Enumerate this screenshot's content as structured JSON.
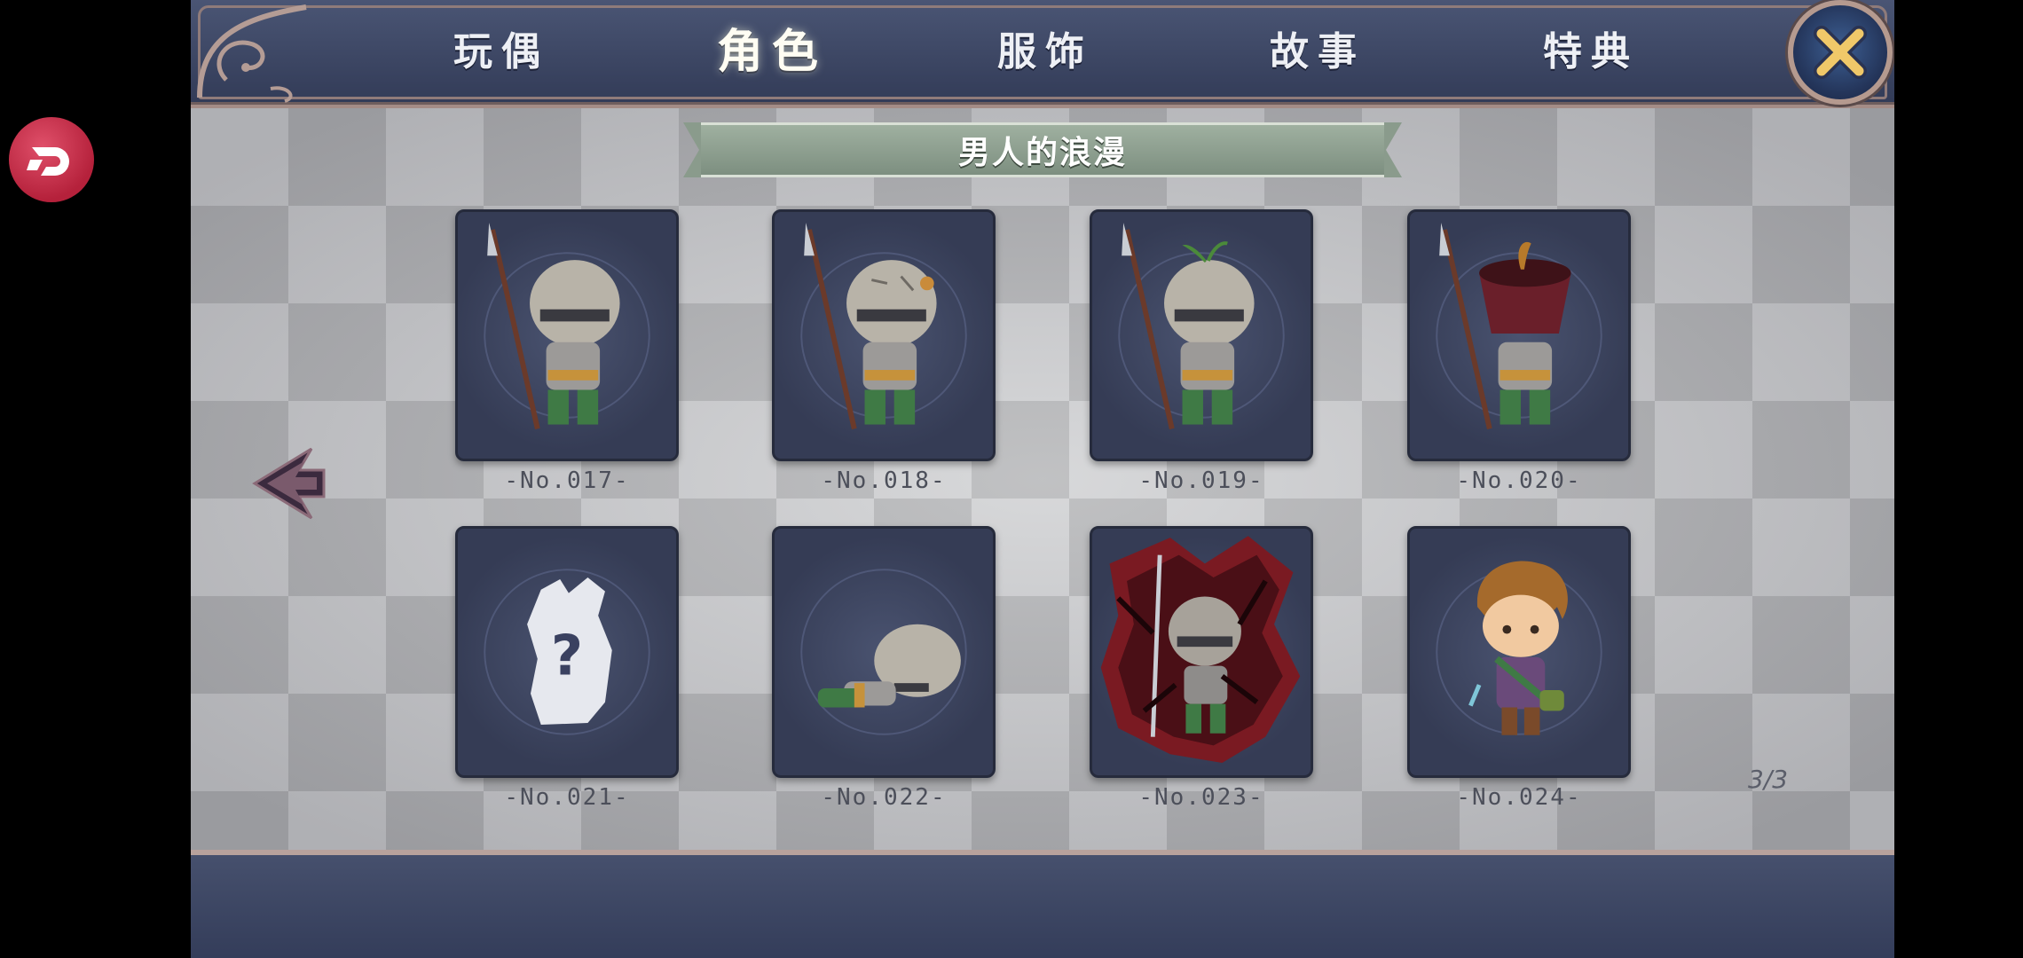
{
  "tabs": [
    {
      "label": "玩偶",
      "active": false
    },
    {
      "label": "角色",
      "active": true
    },
    {
      "label": "服饰",
      "active": false
    },
    {
      "label": "故事",
      "active": false
    },
    {
      "label": "特典",
      "active": false
    }
  ],
  "section_title": "男人的浪漫",
  "cards": [
    {
      "label": "-No.017-",
      "icon": "knight-spear-icon"
    },
    {
      "label": "-No.018-",
      "icon": "knight-spear-patched-helmet-icon"
    },
    {
      "label": "-No.019-",
      "icon": "knight-spear-sprout-icon"
    },
    {
      "label": "-No.020-",
      "icon": "knight-pot-head-icon"
    },
    {
      "label": "-No.021-",
      "icon": "locked-mystery-icon"
    },
    {
      "label": "-No.022-",
      "icon": "knight-fallen-icon"
    },
    {
      "label": "-No.023-",
      "icon": "knight-shattered-red-icon"
    },
    {
      "label": "-No.024-",
      "icon": "brown-haired-boy-icon"
    }
  ],
  "page_indicator": "3/3",
  "colors": {
    "panel": "#3b4461",
    "card": "#3f4762",
    "ribbon": "#8a9b8c",
    "badge": "#c0253f"
  }
}
